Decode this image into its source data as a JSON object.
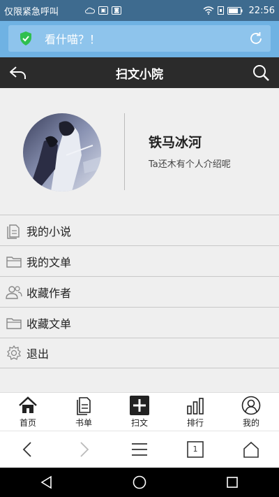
{
  "status_bar": {
    "carrier_text": "仅限紧急呼叫",
    "time": "22:56"
  },
  "browser": {
    "search_text": "看什喵？！",
    "tab_count": "1"
  },
  "app_header": {
    "title": "扫文小院"
  },
  "profile": {
    "username": "铁马冰河",
    "intro": "Ta还木有个人介绍呢"
  },
  "menu": [
    {
      "label": "我的小说",
      "icon": "document-icon"
    },
    {
      "label": "我的文单",
      "icon": "folder-icon"
    },
    {
      "label": "收藏作者",
      "icon": "people-icon"
    },
    {
      "label": "收藏文单",
      "icon": "folder-icon"
    },
    {
      "label": "退出",
      "icon": "gear-icon"
    }
  ],
  "bottom_nav": [
    {
      "label": "首页",
      "icon": "home-icon"
    },
    {
      "label": "书单",
      "icon": "booklist-icon"
    },
    {
      "label": "扫文",
      "icon": "plus-icon"
    },
    {
      "label": "排行",
      "icon": "bar-chart-icon"
    },
    {
      "label": "我的",
      "icon": "user-icon"
    }
  ],
  "colors": {
    "status_bar": "#3e6b8f",
    "browser_bar": "#6fb2e3",
    "app_header": "#2b2b2b",
    "shield_green": "#2fbf4f"
  }
}
